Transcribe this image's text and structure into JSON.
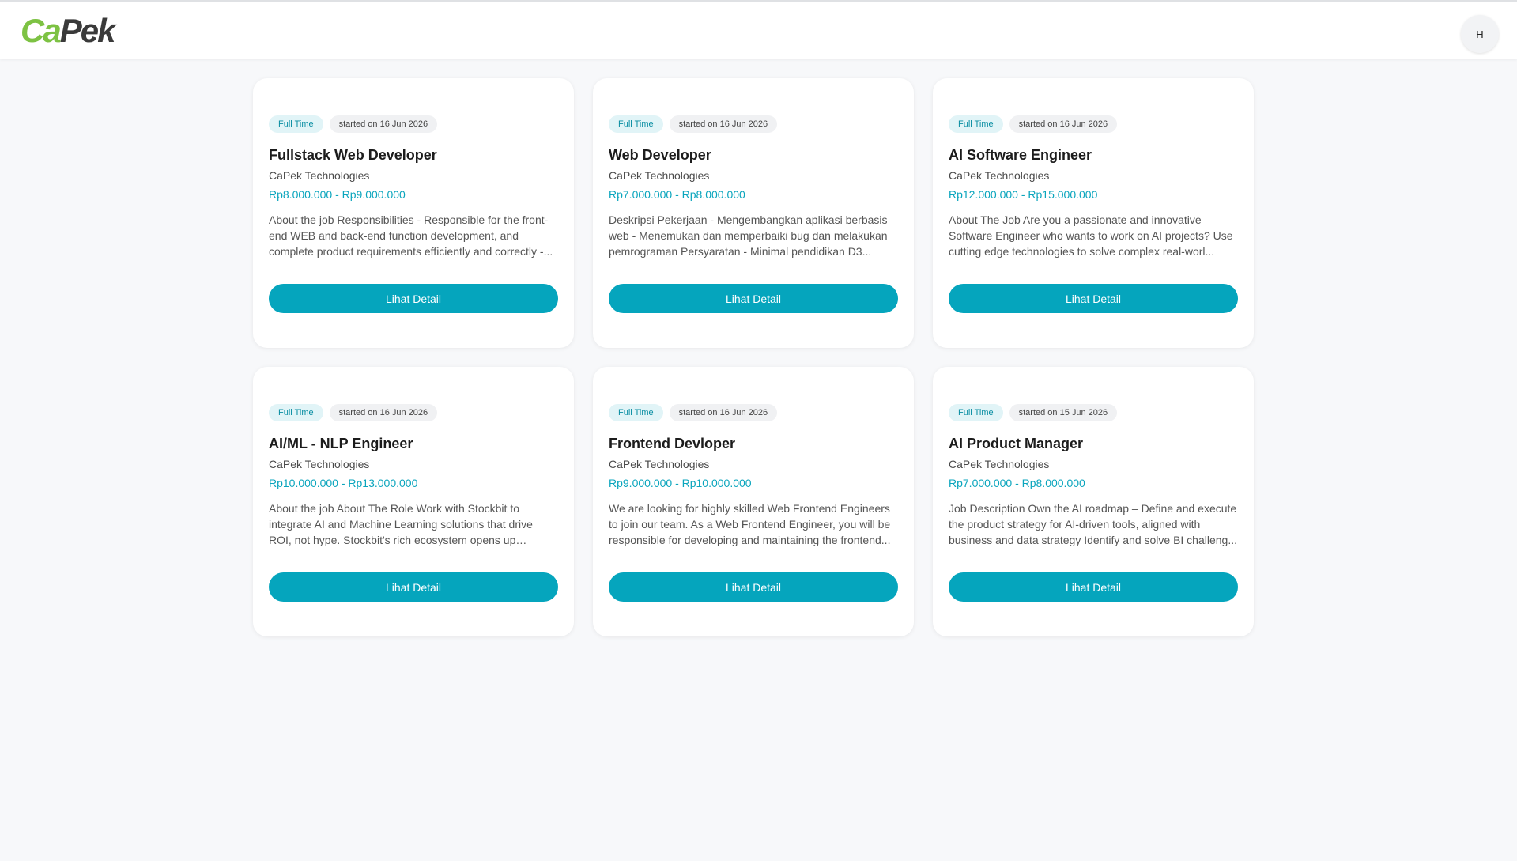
{
  "header": {
    "logo_part1": "Ca",
    "logo_part2": "Pek",
    "avatar_initial": "H"
  },
  "jobs": [
    {
      "type": "Full Time",
      "started": "started on 16 Jun 2026",
      "title": "Fullstack Web Developer",
      "company": "CaPek Technologies",
      "salary": "Rp8.000.000 - Rp9.000.000",
      "description": "About the job Responsibilities - Responsible for the front-end WEB and back-end function development, and complete product requirements efficiently and correctly -...",
      "button": "Lihat Detail"
    },
    {
      "type": "Full Time",
      "started": "started on 16 Jun 2026",
      "title": "Web Developer",
      "company": "CaPek Technologies",
      "salary": "Rp7.000.000 - Rp8.000.000",
      "description": "Deskripsi Pekerjaan - Mengembangkan aplikasi berbasis web - Menemukan dan memperbaiki bug dan melakukan pemrograman Persyaratan - Minimal pendidikan D3...",
      "button": "Lihat Detail"
    },
    {
      "type": "Full Time",
      "started": "started on 16 Jun 2026",
      "title": "AI Software Engineer",
      "company": "CaPek Technologies",
      "salary": "Rp12.000.000 - Rp15.000.000",
      "description": "About The Job Are you a passionate and innovative Software Engineer who wants to work on AI projects? Use cutting edge technologies to solve complex real-worl...",
      "button": "Lihat Detail"
    },
    {
      "type": "Full Time",
      "started": "started on 16 Jun 2026",
      "title": "AI/ML - NLP Engineer",
      "company": "CaPek Technologies",
      "salary": "Rp10.000.000 - Rp13.000.000",
      "description": "About the job About The Role Work with Stockbit to integrate AI and Machine Learning solutions that drive ROI, not hype. Stockbit's rich ecosystem opens up projects...",
      "button": "Lihat Detail"
    },
    {
      "type": "Full Time",
      "started": "started on 16 Jun 2026",
      "title": "Frontend Devloper",
      "company": "CaPek Technologies",
      "salary": "Rp9.000.000 - Rp10.000.000",
      "description": "We are looking for highly skilled Web Frontend Engineers to join our team. As a Web Frontend Engineer, you will be responsible for developing and maintaining the frontend...",
      "button": "Lihat Detail"
    },
    {
      "type": "Full Time",
      "started": "started on 15 Jun 2026",
      "title": "AI Product Manager",
      "company": "CaPek Technologies",
      "salary": "Rp7.000.000 - Rp8.000.000",
      "description": "Job Description Own the AI roadmap – Define and execute the product strategy for AI-driven tools, aligned with business and data strategy Identify and solve BI challeng...",
      "button": "Lihat Detail"
    }
  ]
}
